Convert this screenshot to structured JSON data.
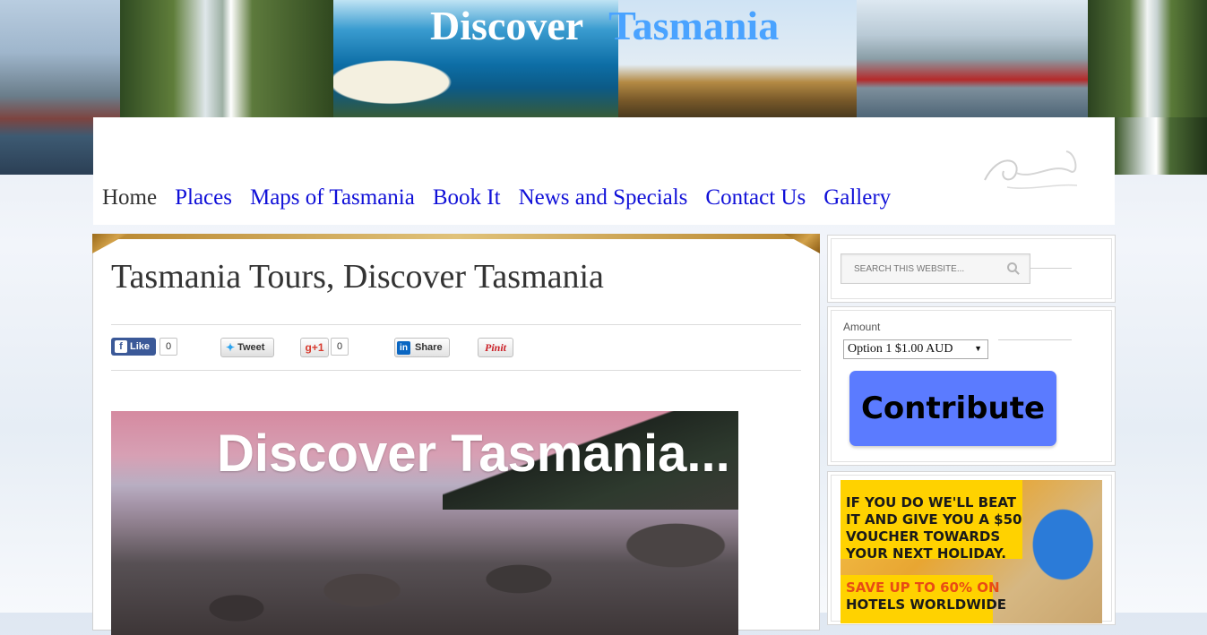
{
  "banner": {
    "title_word1": "Discover",
    "title_word2": "Tasmania"
  },
  "nav": {
    "items": [
      {
        "label": "Home",
        "active": true
      },
      {
        "label": "Places"
      },
      {
        "label": "Maps of Tasmania"
      },
      {
        "label": "Book It"
      },
      {
        "label": "News and Specials"
      },
      {
        "label": "Contact Us"
      },
      {
        "label": "Gallery"
      }
    ]
  },
  "post": {
    "title": "Tasmania Tours, Discover Tasmania",
    "share": {
      "facebook_label": "Like",
      "facebook_count": "0",
      "twitter_label": "Tweet",
      "gplus_label": "+1",
      "gplus_count": "0",
      "linkedin_label": "Share",
      "pinterest_label": "Pinit"
    },
    "hero_text": "Discover Tasmania..."
  },
  "sidebar": {
    "search": {
      "placeholder": "SEARCH THIS WEBSITE..."
    },
    "donate": {
      "amount_label": "Amount",
      "selected_option": "Option 1 $1.00 AUD",
      "contribute_label": "Contribute"
    },
    "ad": {
      "line1": "IF YOU DO WE'LL BEAT",
      "line2": "IT AND GIVE YOU A $50",
      "line3": "VOUCHER TOWARDS",
      "line4": "YOUR NEXT HOLIDAY.",
      "line5": "SAVE UP TO 60% ON",
      "line6": "HOTELS WORLDWIDE"
    }
  },
  "colors": {
    "nav_link": "#1010d8",
    "title_accent": "#4aa3ff",
    "contribute_bg": "#5b7bff"
  }
}
